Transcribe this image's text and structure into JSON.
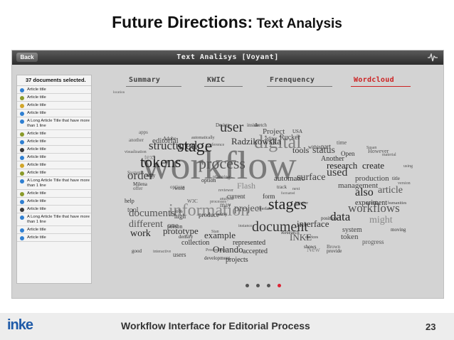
{
  "slide": {
    "title_bold": "Future Directions:",
    "title_rest": " Text Analysis",
    "footer": "Workflow Interface for Editorial Process",
    "page_number": "23",
    "logo": "inke"
  },
  "app": {
    "back_label": "Back",
    "title": "Text Analisys [Voyant]",
    "right_icon": "waveform-icon"
  },
  "sidebar": {
    "header": "37 documents selected.",
    "items": [
      {
        "label": "Article title",
        "color": "#2f7fd1"
      },
      {
        "label": "Article title",
        "color": "#8a9a2a"
      },
      {
        "label": "Article title",
        "color": "#d1a52a"
      },
      {
        "label": "Article title",
        "color": "#2f7fd1"
      },
      {
        "label": "A Long Article Title that have more than 1 line",
        "color": "#2f7fd1"
      },
      {
        "label": "Article title",
        "color": "#8a9a2a"
      },
      {
        "label": "Article title",
        "color": "#2f7fd1"
      },
      {
        "label": "Article title",
        "color": "#3a3a3a"
      },
      {
        "label": "Article title",
        "color": "#2f7fd1"
      },
      {
        "label": "Article title",
        "color": "#d1a52a"
      },
      {
        "label": "Article title",
        "color": "#8a9a2a"
      },
      {
        "label": "A Long Article Title that have more than 1 line",
        "color": "#2f7fd1"
      },
      {
        "label": "Article title",
        "color": "#8a9a2a"
      },
      {
        "label": "Article title",
        "color": "#2f7fd1"
      },
      {
        "label": "Article title",
        "color": "#3a3a3a"
      },
      {
        "label": "A Long Article Title that have more than 1 line",
        "color": "#2f7fd1"
      },
      {
        "label": "Article title",
        "color": "#2f7fd1"
      },
      {
        "label": "Article title",
        "color": "#2f7fd1"
      }
    ]
  },
  "tabs": [
    {
      "label": "Summary",
      "active": false
    },
    {
      "label": "KWIC",
      "active": false
    },
    {
      "label": "Frenquency",
      "active": false
    },
    {
      "label": "Wordcloud",
      "active": true
    }
  ],
  "wordcloud": [
    {
      "t": "workflow",
      "s": 56,
      "c": "#7a7a7a"
    },
    {
      "t": "information",
      "s": 24,
      "c": "#8a8a8a"
    },
    {
      "t": "digital",
      "s": 26,
      "c": "#7f7f7f"
    },
    {
      "t": "stage",
      "s": 24,
      "c": "#222"
    },
    {
      "t": "stages",
      "s": 22,
      "c": "#222"
    },
    {
      "t": "tokens",
      "s": 22,
      "c": "#222"
    },
    {
      "t": "process",
      "s": 22,
      "c": "#555"
    },
    {
      "t": "user",
      "s": 20,
      "c": "#333"
    },
    {
      "t": "document",
      "s": 20,
      "c": "#333"
    },
    {
      "t": "structured",
      "s": 17,
      "c": "#333"
    },
    {
      "t": "order",
      "s": 17,
      "c": "#444"
    },
    {
      "t": "used",
      "s": 16,
      "c": "#333"
    },
    {
      "t": "workflows",
      "s": 17,
      "c": "#555"
    },
    {
      "t": "documents",
      "s": 15,
      "c": "#555"
    },
    {
      "t": "different",
      "s": 14,
      "c": "#555"
    },
    {
      "t": "project",
      "s": 14,
      "c": "#555"
    },
    {
      "t": "data",
      "s": 17,
      "c": "#222"
    },
    {
      "t": "might",
      "s": 14,
      "c": "#888"
    },
    {
      "t": "status",
      "s": 14,
      "c": "#444"
    },
    {
      "t": "research",
      "s": 13,
      "c": "#222"
    },
    {
      "t": "create",
      "s": 13,
      "c": "#222"
    },
    {
      "t": "surface",
      "s": 14,
      "c": "#444"
    },
    {
      "t": "also",
      "s": 16,
      "c": "#222"
    },
    {
      "t": "article",
      "s": 14,
      "c": "#555"
    },
    {
      "t": "work",
      "s": 14,
      "c": "#222"
    },
    {
      "t": "prototype",
      "s": 13,
      "c": "#333"
    },
    {
      "t": "example",
      "s": 13,
      "c": "#333"
    },
    {
      "t": "interface",
      "s": 13,
      "c": "#333"
    },
    {
      "t": "Radzikowska",
      "s": 13,
      "c": "#333"
    },
    {
      "t": "Orlando",
      "s": 13,
      "c": "#333"
    },
    {
      "t": "INKE",
      "s": 13,
      "c": "#555"
    },
    {
      "t": "editorial",
      "s": 11,
      "c": "#444"
    },
    {
      "t": "tools",
      "s": 12,
      "c": "#333"
    },
    {
      "t": "Flash",
      "s": 12,
      "c": "#888"
    },
    {
      "t": "automatic",
      "s": 11,
      "c": "#333"
    },
    {
      "t": "management",
      "s": 11,
      "c": "#444"
    },
    {
      "t": "production",
      "s": 11,
      "c": "#444"
    },
    {
      "t": "experiment",
      "s": 10,
      "c": "#333"
    },
    {
      "t": "Project",
      "s": 11,
      "c": "#444"
    },
    {
      "t": "Rucker",
      "s": 10,
      "c": "#444"
    },
    {
      "t": "Another",
      "s": 10,
      "c": "#333"
    },
    {
      "t": "token",
      "s": 11,
      "c": "#444"
    },
    {
      "t": "system",
      "s": 10,
      "c": "#444"
    },
    {
      "t": "represented",
      "s": 10,
      "c": "#333"
    },
    {
      "t": "collection",
      "s": 10,
      "c": "#333"
    },
    {
      "t": "accepted",
      "s": 10,
      "c": "#333"
    },
    {
      "t": "projects",
      "s": 10,
      "c": "#333"
    },
    {
      "t": "New",
      "s": 10,
      "c": "#888"
    },
    {
      "t": "progress",
      "s": 9,
      "c": "#555"
    },
    {
      "t": "current",
      "s": 9,
      "c": "#333"
    },
    {
      "t": "form",
      "s": 9,
      "c": "#333"
    },
    {
      "t": "tool",
      "s": 10,
      "c": "#555"
    },
    {
      "t": "help",
      "s": 8,
      "c": "#333"
    },
    {
      "t": "high",
      "s": 9,
      "c": "#333"
    },
    {
      "t": "produce",
      "s": 9,
      "c": "#333"
    },
    {
      "t": "users",
      "s": 9,
      "c": "#444"
    },
    {
      "t": "development",
      "s": 7,
      "c": "#333"
    },
    {
      "t": "text",
      "s": 10,
      "c": "#888"
    },
    {
      "t": "way",
      "s": 8,
      "c": "#333"
    },
    {
      "t": "option",
      "s": 8,
      "c": "#333"
    },
    {
      "t": "Design",
      "s": 7,
      "c": "#444"
    },
    {
      "t": "sketch",
      "s": 7,
      "c": "#444"
    },
    {
      "t": "inside",
      "s": 7,
      "c": "#444"
    },
    {
      "t": "Milena",
      "s": 7,
      "c": "#333"
    },
    {
      "t": "Systems",
      "s": 7,
      "c": "#555"
    },
    {
      "t": "visualization",
      "s": 6,
      "c": "#555"
    },
    {
      "t": "apps",
      "s": 7,
      "c": "#555"
    },
    {
      "t": "another",
      "s": 7,
      "c": "#555"
    },
    {
      "t": "Adobe",
      "s": 7,
      "c": "#333"
    },
    {
      "t": "automatically",
      "s": 6,
      "c": "#444"
    },
    {
      "t": "editor",
      "s": 7,
      "c": "#444"
    },
    {
      "t": "USA",
      "s": 7,
      "c": "#333"
    },
    {
      "t": "within",
      "s": 7,
      "c": "#333"
    },
    {
      "t": "part",
      "s": 9,
      "c": "#333"
    },
    {
      "t": "time",
      "s": 8,
      "c": "#555"
    },
    {
      "t": "Open",
      "s": 9,
      "c": "#333"
    },
    {
      "t": "However",
      "s": 8,
      "c": "#555"
    },
    {
      "t": "Susan",
      "s": 6,
      "c": "#555"
    },
    {
      "t": "material",
      "s": 6,
      "c": "#555"
    },
    {
      "t": "using",
      "s": 6,
      "c": "#555"
    },
    {
      "t": "title",
      "s": 7,
      "c": "#333"
    },
    {
      "t": "version",
      "s": 6,
      "c": "#555"
    },
    {
      "t": "useful",
      "s": 6,
      "c": "#555"
    },
    {
      "t": "humanities",
      "s": 6,
      "c": "#444"
    },
    {
      "t": "moving",
      "s": 7,
      "c": "#333"
    },
    {
      "t": "instance",
      "s": 6,
      "c": "#555"
    },
    {
      "t": "Research",
      "s": 7,
      "c": "#333"
    },
    {
      "t": "position",
      "s": 7,
      "c": "#333"
    },
    {
      "t": "provide",
      "s": 7,
      "c": "#333"
    },
    {
      "t": "Brown",
      "s": 7,
      "c": "#555"
    },
    {
      "t": "shows",
      "s": 7,
      "c": "#333"
    },
    {
      "t": "devices",
      "s": 6,
      "c": "#333"
    },
    {
      "t": "one",
      "s": 11,
      "c": "#555"
    },
    {
      "t": "person",
      "s": 8,
      "c": "#333"
    },
    {
      "t": "density",
      "s": 7,
      "c": "#333"
    },
    {
      "t": "good",
      "s": 7,
      "c": "#333"
    },
    {
      "t": "interactive",
      "s": 6,
      "c": "#555"
    },
    {
      "t": "Proceedings",
      "s": 6,
      "c": "#555"
    },
    {
      "t": "reviewer",
      "s": 6,
      "c": "#555"
    },
    {
      "t": "conference",
      "s": 6,
      "c": "#555"
    },
    {
      "t": "analysis",
      "s": 6,
      "c": "#555"
    },
    {
      "t": "planning",
      "s": 7,
      "c": "#444"
    },
    {
      "t": "track",
      "s": 7,
      "c": "#444"
    },
    {
      "t": "options",
      "s": 7,
      "c": "#555"
    },
    {
      "t": "word",
      "s": 7,
      "c": "#333"
    },
    {
      "t": "offer",
      "s": 7,
      "c": "#555"
    },
    {
      "t": "processes",
      "s": 6,
      "c": "#555"
    },
    {
      "t": "may",
      "s": 9,
      "c": "#555"
    },
    {
      "t": "easy",
      "s": 7,
      "c": "#333"
    },
    {
      "t": "W3C",
      "s": 7,
      "c": "#555"
    },
    {
      "t": "jobs",
      "s": 7,
      "c": "#333"
    },
    {
      "t": "Stan",
      "s": 6,
      "c": "#555"
    },
    {
      "t": "Interface",
      "s": 6,
      "c": "#333"
    },
    {
      "t": "Weaver",
      "s": 6,
      "c": "#333"
    },
    {
      "t": "next",
      "s": 6,
      "c": "#555"
    },
    {
      "t": "formatted",
      "s": 5,
      "c": "#555"
    },
    {
      "t": "location",
      "s": 5,
      "c": "#555"
    }
  ],
  "pager": {
    "count": 4,
    "active": 3
  }
}
